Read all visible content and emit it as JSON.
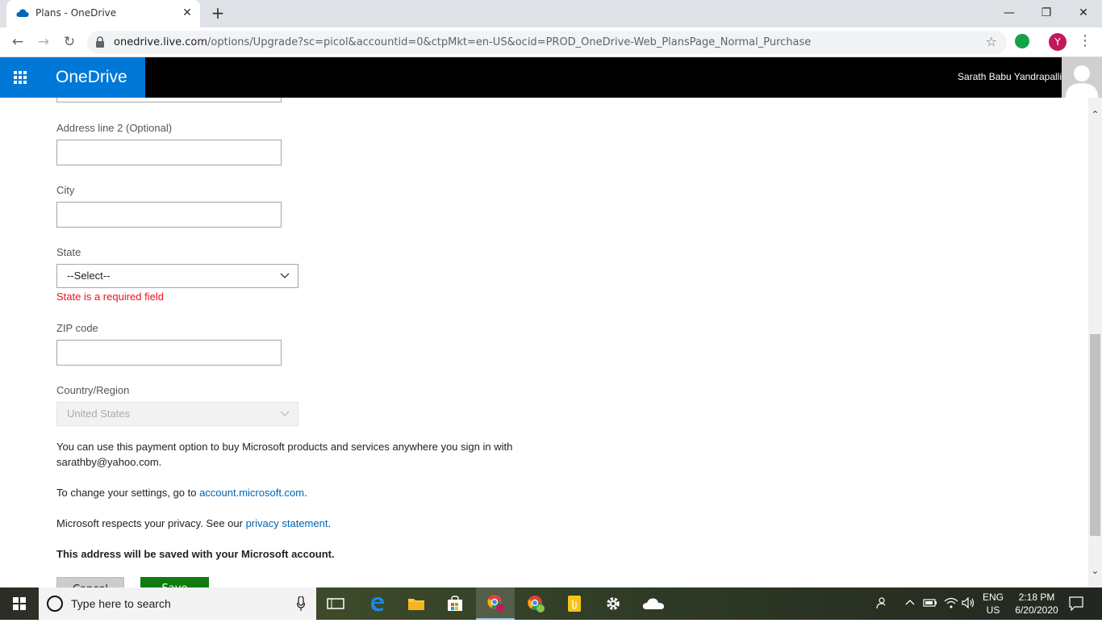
{
  "browser": {
    "tab_title": "Plans - OneDrive",
    "tab_close": "✕",
    "new_tab": "+",
    "window_controls": {
      "minimize": "—",
      "restore": "❐",
      "close": "✕"
    },
    "nav": {
      "back": "←",
      "forward": "→",
      "reload": "↻"
    },
    "url_host": "onedrive.live.com",
    "url_path": "/options/Upgrade?sc=picol&accountid=0&ctpMkt=en-US&ocid=PROD_OneDrive-Web_PlansPage_Normal_Purchase",
    "bookmark_star": "☆",
    "profile_initial": "Y",
    "menu": "⋮"
  },
  "header": {
    "brand": "OneDrive",
    "user_name": "Sarath Babu Yandrapalli",
    "brand_color": "#0078d7"
  },
  "form": {
    "address2_label": "Address line 2 (Optional)",
    "city_label": "City",
    "state_label": "State",
    "state_value": "--Select--",
    "state_error": "State is a required field",
    "zip_label": "ZIP code",
    "country_label": "Country/Region",
    "country_value": "United States",
    "info_text": "You can use this payment option to buy Microsoft products and services anywhere you sign in with sarathby@yahoo.com.",
    "settings_text_before": "To change your settings, go to ",
    "settings_link": "account.microsoft.com",
    "settings_text_after": ".",
    "privacy_text_before": "Microsoft respects your privacy. See our ",
    "privacy_link": "privacy statement",
    "privacy_text_after": ".",
    "save_note": "This address will be saved with your Microsoft account.",
    "cancel_label": "Cancel",
    "save_label": "Save",
    "error_color": "#e81123",
    "save_color": "#107c10"
  },
  "scrollbar": {
    "up": "⌃",
    "down": "⌄"
  },
  "taskbar": {
    "search_placeholder": "Type here to search",
    "language": "ENG",
    "region": "US",
    "time": "2:18 PM",
    "date": "6/20/2020",
    "icons": [
      "task-view-icon",
      "edge-icon",
      "file-explorer-icon",
      "store-icon",
      "chrome-profile-icon",
      "chrome-icon",
      "sticky-notes-icon",
      "settings-icon",
      "onedrive-icon"
    ]
  }
}
